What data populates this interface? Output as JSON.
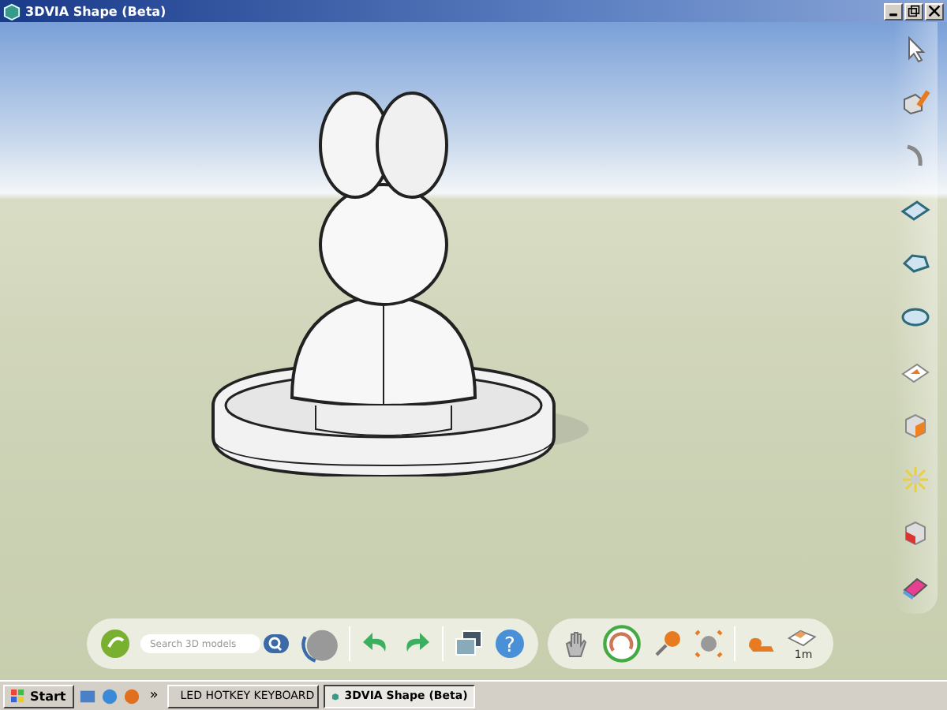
{
  "window": {
    "title": "3DVIA Shape (Beta)"
  },
  "toolbar": {
    "search": {
      "placeholder": "Search 3D models"
    },
    "scale_label": "1m",
    "help_glyph": "?"
  },
  "taskbar": {
    "start": "Start",
    "overflow": "»",
    "tasks": [
      {
        "label": "LED HOTKEY KEYBOARD",
        "selected": false
      },
      {
        "label": "3DVIA Shape (Beta)",
        "selected": true
      }
    ]
  }
}
